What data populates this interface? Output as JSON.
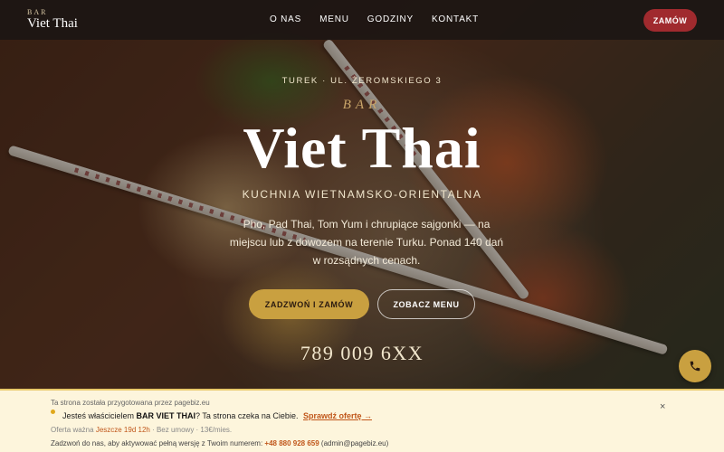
{
  "header": {
    "logo_small": "BAR",
    "logo_big": "Viet Thai",
    "nav": [
      "O NAS",
      "MENU",
      "GODZINY",
      "KONTAKT"
    ],
    "order_button": "ZAMÓW"
  },
  "hero": {
    "address": "TUREK · UL. ŻEROMSKIEGO 3",
    "bar_label": "BAR",
    "title": "Viet Thai",
    "subtitle": "KUCHNIA WIETNAMSKO-ORIENTALNA",
    "description": "Pho, Pad Thai, Tom Yum i chrupiące sajgonki — na miejscu lub z dowozem na terenie Turku. Ponad 140 dań w rozsądnych cenach.",
    "call_button": "ZADZWOŃ I ZAMÓW",
    "menu_button": "ZOBACZ MENU",
    "phone": "789 009 6XX"
  },
  "banner": {
    "line1": "Ta strona została przygotowana przez pagebiz.eu",
    "line2_pre": "Jesteś właścicielem ",
    "line2_name": "BAR VIET THAI",
    "line2_post": "?  Ta strona czeka na Ciebie.",
    "line2_link": "Sprawdź ofertę →",
    "line3_pre": "Oferta ważna ",
    "line3_time": "Jeszcze 19d 12h",
    "line3_post": " · Bez umowy · 13€/mies.",
    "line4_pre": "Zadzwoń do nas, aby aktywować pełną wersję z Twoim numerem: ",
    "line4_phone": "+48 880 928 659",
    "line4_post": " (admin@pagebiz.eu)",
    "close": "×"
  },
  "colors": {
    "accent_red": "#a02a2e",
    "accent_gold": "#c9a040",
    "banner_bg": "#fdf5dc",
    "link_orange": "#c0561a"
  }
}
